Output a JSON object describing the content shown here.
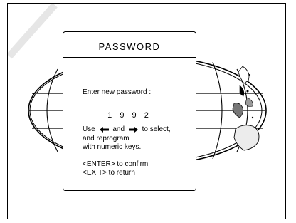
{
  "dialog": {
    "title": "PASSWORD",
    "prompt": "Enter new password :",
    "password_value": "1 9 9 2",
    "instructions": {
      "use_word": "Use",
      "and_word": "and",
      "to_select": "to select,",
      "line2": "and reprogram",
      "line3": "with numeric keys."
    },
    "enter_hint": "<ENTER> to confirm",
    "exit_hint": "<EXIT> to return"
  },
  "icons": {
    "left_arrow": "left-arrow-icon",
    "right_arrow": "right-arrow-icon",
    "background": "world-map-icon"
  }
}
